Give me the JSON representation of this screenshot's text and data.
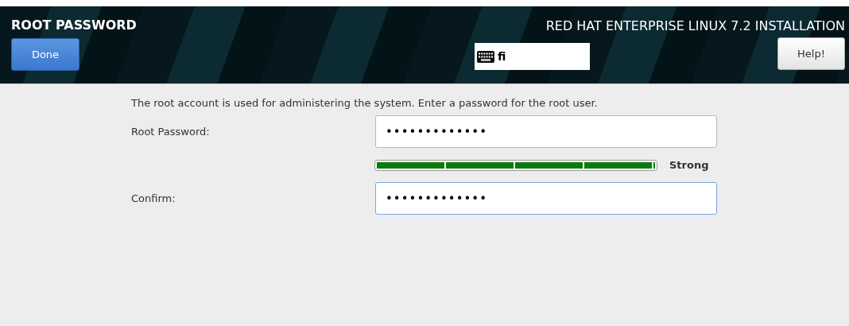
{
  "header": {
    "title": "ROOT PASSWORD",
    "done_button": "Done",
    "product_title": "RED HAT ENTERPRISE LINUX 7.2 INSTALLATION",
    "keyboard_layout": "fi",
    "help_button": "Help!"
  },
  "intro": "The root account is used for administering the system.  Enter a password for the root user.",
  "fields": [
    {
      "label": "Root Password:",
      "value": "•••••••••••••",
      "focused": false
    },
    {
      "label": "Confirm:",
      "value": "•••••••••••••",
      "focused": true
    }
  ],
  "strength": {
    "level": 1,
    "reading": "Strong"
  }
}
